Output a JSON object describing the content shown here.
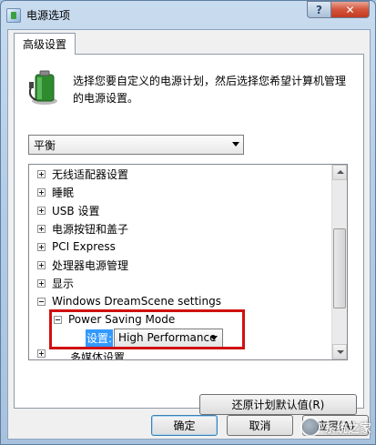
{
  "window": {
    "title": "电源选项",
    "help_label": "?",
    "close_label": "✕"
  },
  "tab": {
    "label": "高级设置"
  },
  "description": "选择您要自定义的电源计划，然后选择您希望计算机管理的电源设置。",
  "plan_select": {
    "value": "平衡"
  },
  "tree": {
    "items": [
      {
        "label": "无线适配器设置",
        "expander": "+"
      },
      {
        "label": "睡眠",
        "expander": "+"
      },
      {
        "label": "USB 设置",
        "expander": "+"
      },
      {
        "label": "电源按钮和盖子",
        "expander": "+"
      },
      {
        "label": "PCI Express",
        "expander": "+"
      },
      {
        "label": "处理器电源管理",
        "expander": "+"
      },
      {
        "label": "显示",
        "expander": "+"
      },
      {
        "label": "Windows DreamScene settings",
        "expander": "-"
      },
      {
        "label": "Power Saving Mode",
        "expander": "-"
      },
      {
        "label": "多媒体设置",
        "expander": "+"
      }
    ],
    "setting_label": "设置:",
    "setting_value": "High Performance"
  },
  "buttons": {
    "restore": "还原计划默认值(R)",
    "ok": "确定",
    "cancel": "取消",
    "apply": "应用(A)"
  },
  "watermark": {
    "text": "系统之家"
  },
  "colors": {
    "highlight_border": "#d01010",
    "selection": "#3399ff"
  }
}
